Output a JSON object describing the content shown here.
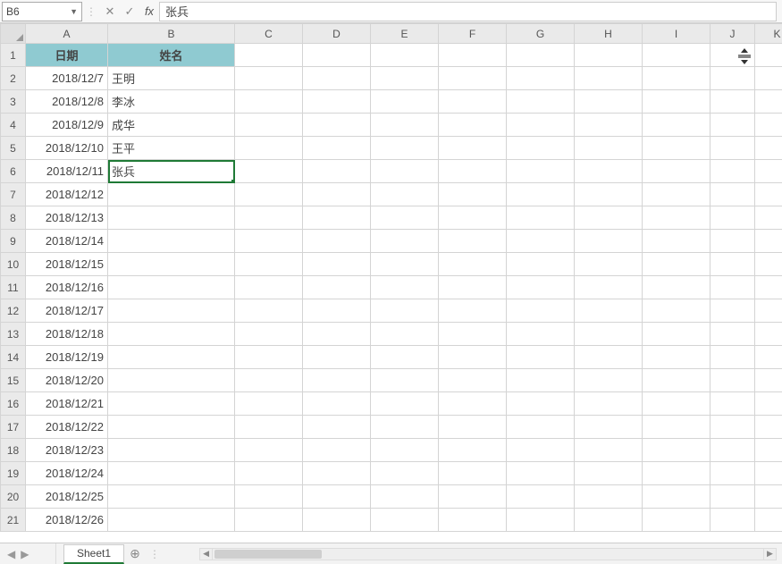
{
  "formula_bar": {
    "name_box": "B6",
    "cancel_icon": "✕",
    "enter_icon": "✓",
    "fx_label": "fx",
    "value": "张兵"
  },
  "columns": [
    "A",
    "B",
    "C",
    "D",
    "E",
    "F",
    "G",
    "H",
    "I",
    "J",
    "K"
  ],
  "active_cell": {
    "col": "B",
    "row": 6
  },
  "headers": {
    "A": "日期",
    "B": "姓名"
  },
  "rows": [
    {
      "n": 1,
      "A": "",
      "B": ""
    },
    {
      "n": 2,
      "A": "2018/12/7",
      "B": "王明"
    },
    {
      "n": 3,
      "A": "2018/12/8",
      "B": "李冰"
    },
    {
      "n": 4,
      "A": "2018/12/9",
      "B": "成华"
    },
    {
      "n": 5,
      "A": "2018/12/10",
      "B": "王平"
    },
    {
      "n": 6,
      "A": "2018/12/11",
      "B": "张兵"
    },
    {
      "n": 7,
      "A": "2018/12/12",
      "B": ""
    },
    {
      "n": 8,
      "A": "2018/12/13",
      "B": ""
    },
    {
      "n": 9,
      "A": "2018/12/14",
      "B": ""
    },
    {
      "n": 10,
      "A": "2018/12/15",
      "B": ""
    },
    {
      "n": 11,
      "A": "2018/12/16",
      "B": ""
    },
    {
      "n": 12,
      "A": "2018/12/17",
      "B": ""
    },
    {
      "n": 13,
      "A": "2018/12/18",
      "B": ""
    },
    {
      "n": 14,
      "A": "2018/12/19",
      "B": ""
    },
    {
      "n": 15,
      "A": "2018/12/20",
      "B": ""
    },
    {
      "n": 16,
      "A": "2018/12/21",
      "B": ""
    },
    {
      "n": 17,
      "A": "2018/12/22",
      "B": ""
    },
    {
      "n": 18,
      "A": "2018/12/23",
      "B": ""
    },
    {
      "n": 19,
      "A": "2018/12/24",
      "B": ""
    },
    {
      "n": 20,
      "A": "2018/12/25",
      "B": ""
    },
    {
      "n": 21,
      "A": "2018/12/26",
      "B": ""
    }
  ],
  "sheet_bar": {
    "active_sheet": "Sheet1",
    "add_icon": "⊕"
  }
}
